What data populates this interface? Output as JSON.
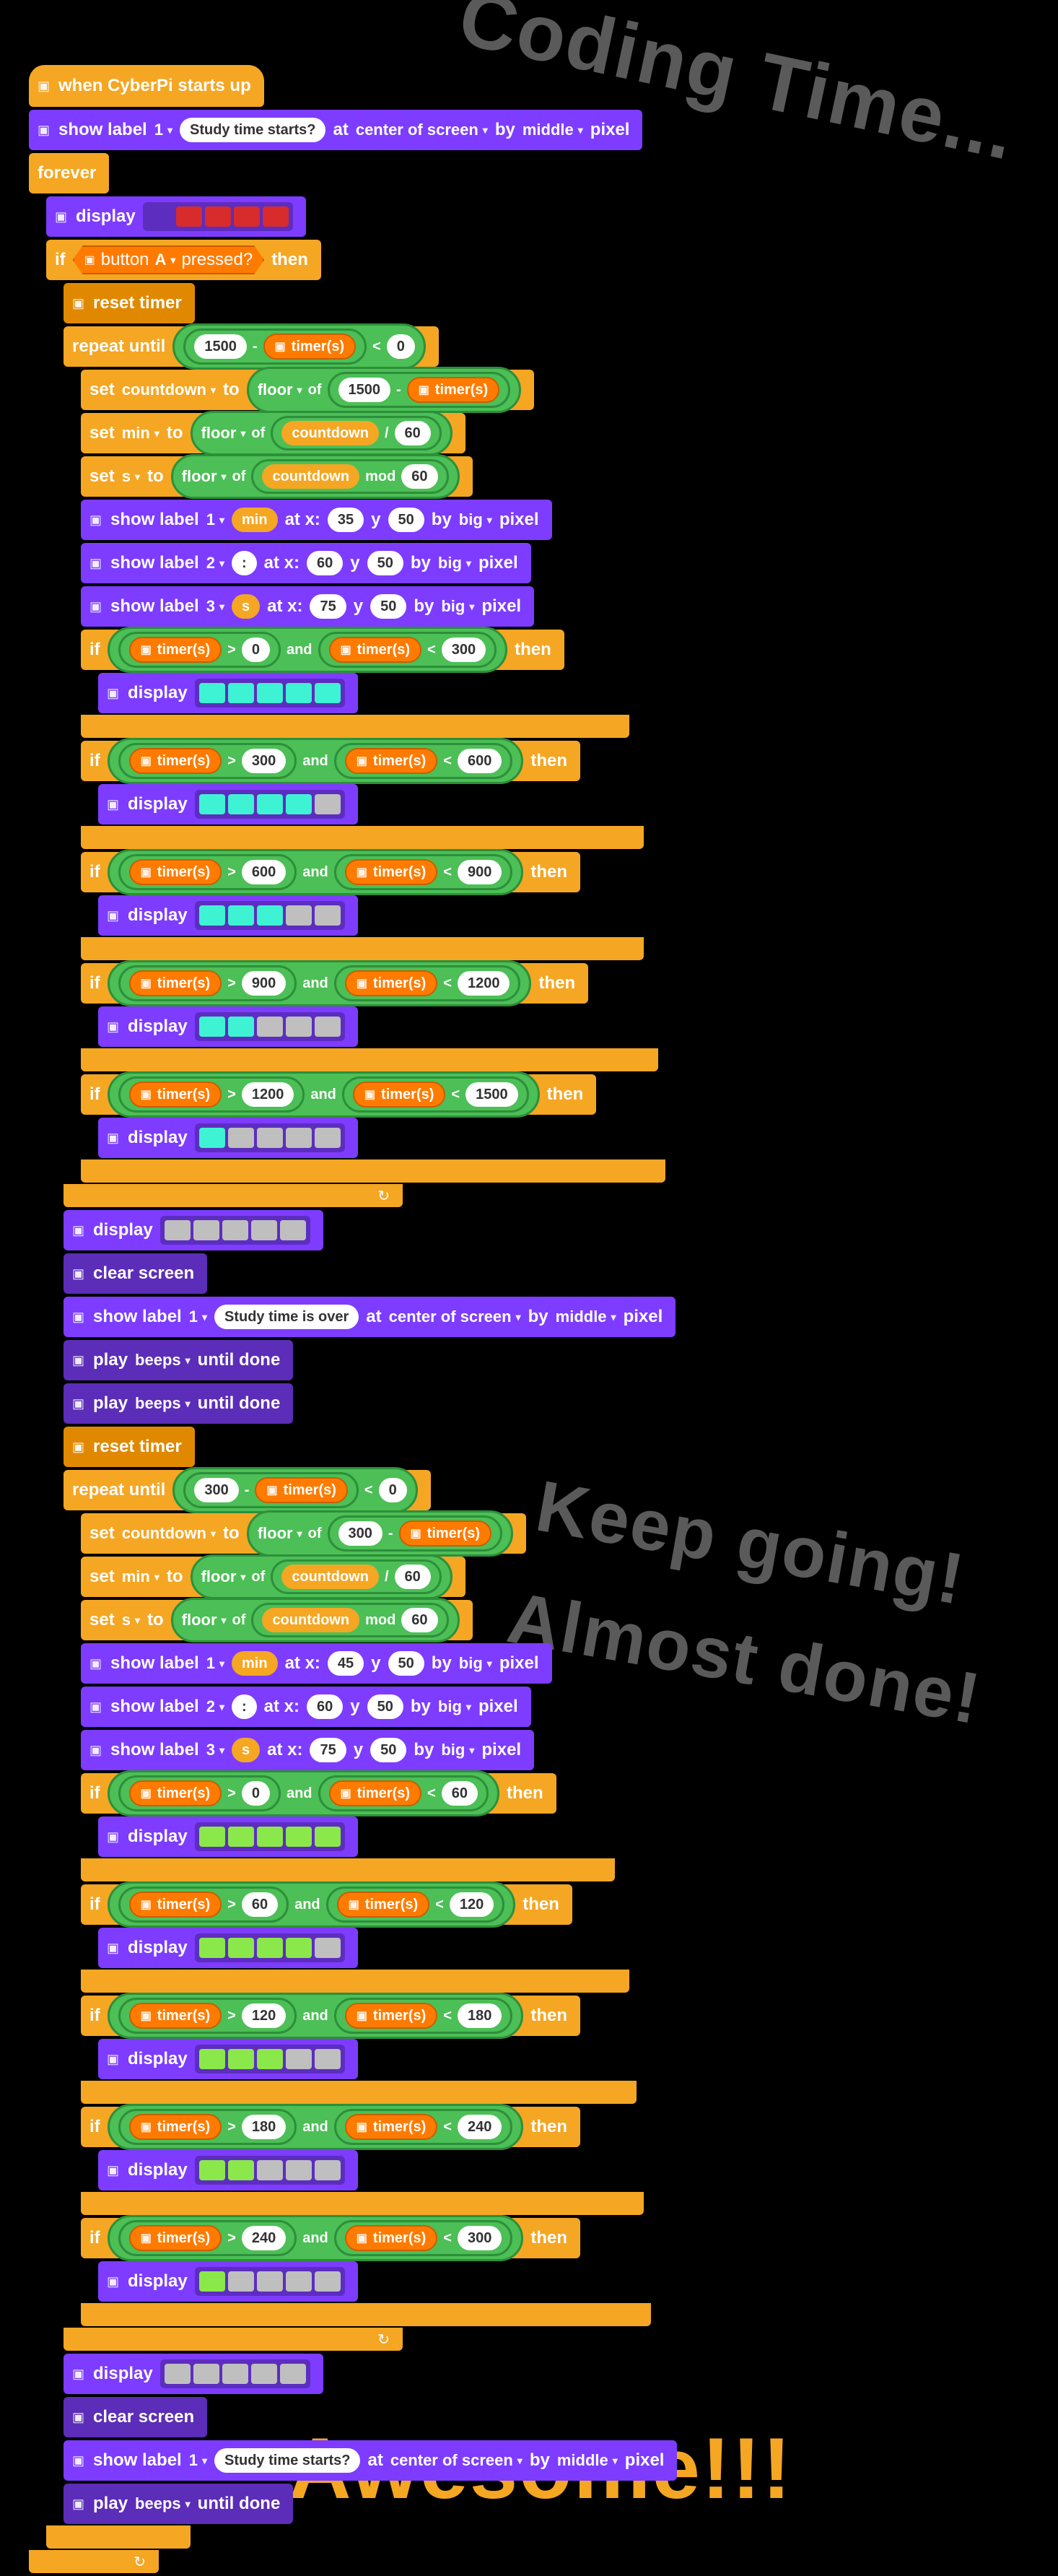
{
  "cheer": {
    "coding": "Coding Time...",
    "keep": "Keep going!",
    "almost": "Almost done!",
    "awesome": "Awesome!!!"
  },
  "hat": {
    "label": "when CyberPi starts up"
  },
  "show_start": {
    "label": "show label",
    "idx": "1",
    "text": "Study time starts?",
    "at": "at",
    "pos": "center of screen",
    "by": "by",
    "align": "middle",
    "unit": "pixel"
  },
  "forever": "forever",
  "display": "display",
  "if": "if",
  "then": "then",
  "btn": {
    "label": "button",
    "which": "A",
    "pressed": "pressed?"
  },
  "reset_timer": "reset timer",
  "repeat_until": "repeat until",
  "timer_s": "timer(s)",
  "set": "set",
  "to": "to",
  "floor": "floor",
  "of": "of",
  "mod": "mod",
  "and": "and",
  "vars": {
    "countdown": "countdown",
    "min": "min",
    "s": "s"
  },
  "nums": {
    "n0": "0",
    "n35": "35",
    "n45": "45",
    "n50": "50",
    "n60": "60",
    "n75": "75",
    "n120": "120",
    "n180": "180",
    "n240": "240",
    "n300": "300",
    "n600": "600",
    "n900": "900",
    "n1200": "1200",
    "n1500": "1500"
  },
  "show_label": "show label",
  "atx": "at x:",
  "y": "y",
  "by": "by",
  "big": "big",
  "pixel": "pixel",
  "colon": ":",
  "clear_screen": "clear screen",
  "study_over": "Study time is over",
  "play": "play",
  "beeps": "beeps",
  "until_done": "until done",
  "led_colors": {
    "red": "#d82b2b",
    "cyan": "#3ef2d4",
    "grey": "#bfbfbf",
    "lime": "#8be84a",
    "dark": "#8a8a8a"
  },
  "idx": {
    "1": "1",
    "2": "2",
    "3": "3"
  },
  "ops": {
    "gt": ">",
    "lt": "<",
    "minus": "-",
    "div": "/"
  }
}
